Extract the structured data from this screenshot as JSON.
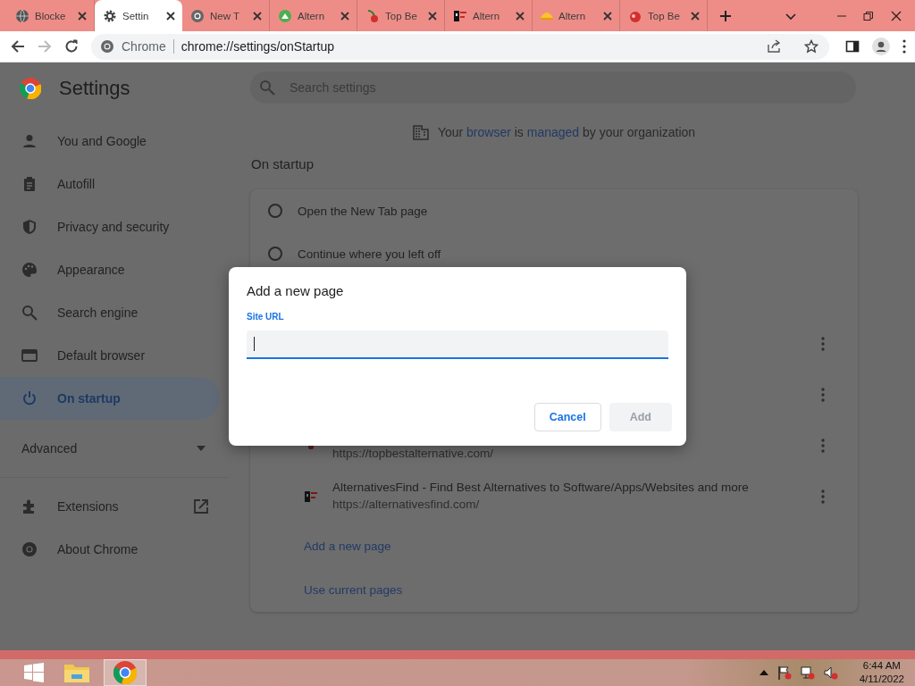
{
  "tabs": [
    {
      "label": "Blocke",
      "selected": false
    },
    {
      "label": "Settin",
      "selected": true
    },
    {
      "label": "New T",
      "selected": false
    },
    {
      "label": "Altern",
      "selected": false
    },
    {
      "label": "Top Be",
      "selected": false
    },
    {
      "label": "Altern",
      "selected": false
    },
    {
      "label": "Altern",
      "selected": false
    },
    {
      "label": "Top Be",
      "selected": false
    }
  ],
  "toolbar": {
    "site_label": "Chrome",
    "url": "chrome://settings/onStartup"
  },
  "settings": {
    "title": "Settings",
    "search_placeholder": "Search settings",
    "sidebar": {
      "items": [
        {
          "label": "You and Google",
          "selected": false
        },
        {
          "label": "Autofill",
          "selected": false
        },
        {
          "label": "Privacy and security",
          "selected": false
        },
        {
          "label": "Appearance",
          "selected": false
        },
        {
          "label": "Search engine",
          "selected": false
        },
        {
          "label": "Default browser",
          "selected": false
        },
        {
          "label": "On startup",
          "selected": true
        }
      ],
      "advanced": {
        "label": "Advanced",
        "expanded": false
      },
      "footer_items": [
        {
          "label": "Extensions"
        },
        {
          "label": "About Chrome"
        }
      ]
    },
    "managed_notice": [
      {
        "text": "Your "
      },
      {
        "text": "browser",
        "link": true
      },
      {
        "text": " is "
      },
      {
        "text": "managed",
        "link": true
      },
      {
        "text": " by your organization"
      }
    ],
    "section_title": "On startup",
    "startup_options": [
      {
        "label": "Open the New Tab page",
        "selected": false
      },
      {
        "label": "Continue where you left off",
        "selected": false
      }
    ],
    "pages": [
      {
        "url": "https://topbestalternative.com/"
      },
      {
        "title": "AlternativesFind - Find Best Alternatives to Software/Apps/Websites and more",
        "url": "https://alternativesfind.com/"
      }
    ],
    "links": [
      "Add a new page",
      "Use current pages"
    ]
  },
  "dialog": {
    "title": "Add a new page",
    "field_label": "Site URL",
    "buttons": [
      {
        "label": "Cancel",
        "disabled": false
      },
      {
        "label": "Add",
        "disabled": true
      }
    ]
  },
  "taskbar": {
    "time": "6:44 AM",
    "date": "4/11/2022"
  }
}
